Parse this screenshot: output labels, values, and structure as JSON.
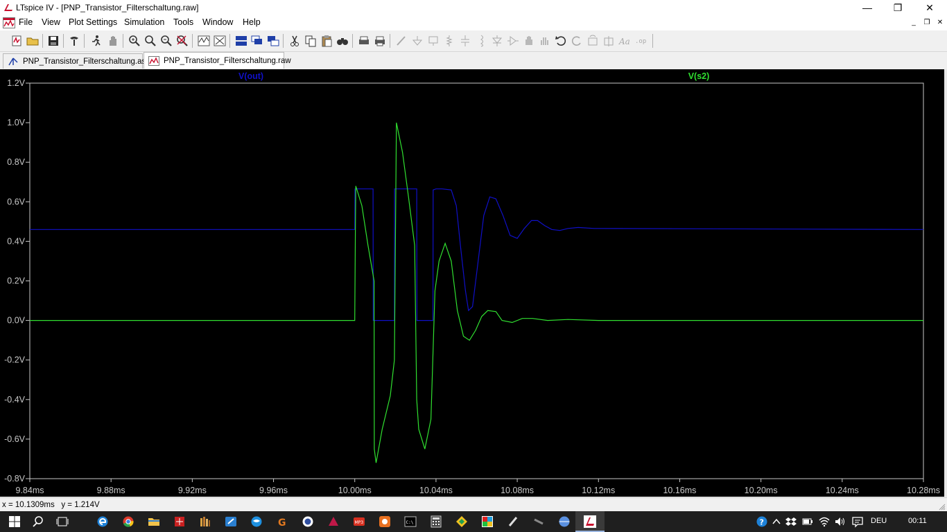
{
  "window": {
    "title": "LTspice IV - [PNP_Transistor_Filterschaltung.raw]",
    "controls": {
      "minimize": "—",
      "restore": "❐",
      "close": "✕"
    }
  },
  "menubar": {
    "items": [
      {
        "label": "File",
        "accel": "F"
      },
      {
        "label": "View",
        "accel": "V"
      },
      {
        "label": "Plot Settings",
        "accel": "P"
      },
      {
        "label": "Simulation",
        "accel": "S"
      },
      {
        "label": "Tools",
        "accel": "T"
      },
      {
        "label": "Window",
        "accel": "W"
      },
      {
        "label": "Help",
        "accel": "H"
      }
    ],
    "mdi_controls": {
      "minimize": "_",
      "restore": "❐",
      "close": "✕"
    }
  },
  "tabs": [
    {
      "label": "PNP_Transistor_Filterschaltung.asc",
      "icon": "schematic-icon",
      "active": false
    },
    {
      "label": "PNP_Transistor_Filterschaltung.raw",
      "icon": "waveform-icon",
      "active": true
    }
  ],
  "statusbar": {
    "cursor_readout": "x = 10.1309ms   y = 1.214V"
  },
  "taskbar": {
    "language": "DEU",
    "time": "00:11"
  },
  "colors": {
    "plot_background": "#000000",
    "trace_vout": "#1010c8",
    "trace_vs2": "#30e030",
    "axis_text": "#c8c8c8"
  },
  "chart_data": {
    "type": "line",
    "xlim": [
      9.84,
      10.28
    ],
    "ylim": [
      -0.8,
      1.2
    ],
    "xticks": [
      9.84,
      9.88,
      9.92,
      9.96,
      10.0,
      10.04,
      10.08,
      10.12,
      10.16,
      10.2,
      10.24,
      10.28
    ],
    "yticks": [
      1.2,
      1.0,
      0.8,
      0.6,
      0.4,
      0.2,
      0.0,
      -0.2,
      -0.4,
      -0.6,
      -0.8
    ],
    "xtick_labels": [
      "9.84ms",
      "9.88ms",
      "9.92ms",
      "9.96ms",
      "10.00ms",
      "10.04ms",
      "10.08ms",
      "10.12ms",
      "10.16ms",
      "10.20ms",
      "10.24ms",
      "10.28ms"
    ],
    "ytick_labels": [
      "1.2V",
      "1.0V",
      "0.8V",
      "0.6V",
      "0.4V",
      "0.2V",
      "0.0V",
      "-0.2V",
      "-0.4V",
      "-0.6V",
      "-0.8V"
    ],
    "grid": false,
    "series": [
      {
        "name": "V(out)",
        "color": "#1010c8",
        "x": [
          9.84,
          10.0,
          10.0001,
          10.009,
          10.0091,
          10.0195,
          10.0196,
          10.0305,
          10.0306,
          10.0385,
          10.0386,
          10.04,
          10.043,
          10.0475,
          10.05,
          10.052,
          10.0545,
          10.056,
          10.058,
          10.0605,
          10.0635,
          10.0665,
          10.0695,
          10.073,
          10.0765,
          10.08,
          10.0835,
          10.087,
          10.09,
          10.0935,
          10.097,
          10.101,
          10.105,
          10.11,
          10.118,
          10.28
        ],
        "y": [
          0.46,
          0.46,
          0.665,
          0.665,
          0.0,
          0.0,
          0.665,
          0.665,
          0.0,
          0.0,
          0.66,
          0.665,
          0.665,
          0.66,
          0.58,
          0.38,
          0.15,
          0.05,
          0.07,
          0.28,
          0.53,
          0.625,
          0.615,
          0.53,
          0.43,
          0.415,
          0.465,
          0.505,
          0.505,
          0.48,
          0.46,
          0.455,
          0.465,
          0.47,
          0.465,
          0.46
        ]
      },
      {
        "name": "V(s2)",
        "color": "#30e030",
        "x": [
          9.84,
          10.0,
          10.0003,
          10.0005,
          10.0035,
          10.0065,
          10.0095,
          10.0096,
          10.0105,
          10.0135,
          10.0175,
          10.0195,
          10.0205,
          10.0235,
          10.0265,
          10.0295,
          10.0305,
          10.0315,
          10.0345,
          10.0375,
          10.0395,
          10.0415,
          10.0445,
          10.0475,
          10.0505,
          10.0535,
          10.0565,
          10.0595,
          10.0625,
          10.0655,
          10.0695,
          10.0725,
          10.0775,
          10.0825,
          10.0875,
          10.095,
          10.105,
          10.12,
          10.28
        ],
        "y": [
          0.0,
          0.0,
          0.45,
          0.68,
          0.58,
          0.38,
          0.2,
          -0.65,
          -0.72,
          -0.55,
          -0.38,
          -0.2,
          1.0,
          0.85,
          0.62,
          0.38,
          -0.4,
          -0.55,
          -0.65,
          -0.5,
          0.15,
          0.3,
          0.39,
          0.3,
          0.05,
          -0.08,
          -0.1,
          -0.05,
          0.02,
          0.05,
          0.045,
          0.0,
          -0.01,
          0.01,
          0.01,
          0.0,
          0.005,
          0.0,
          0.0
        ]
      }
    ]
  }
}
